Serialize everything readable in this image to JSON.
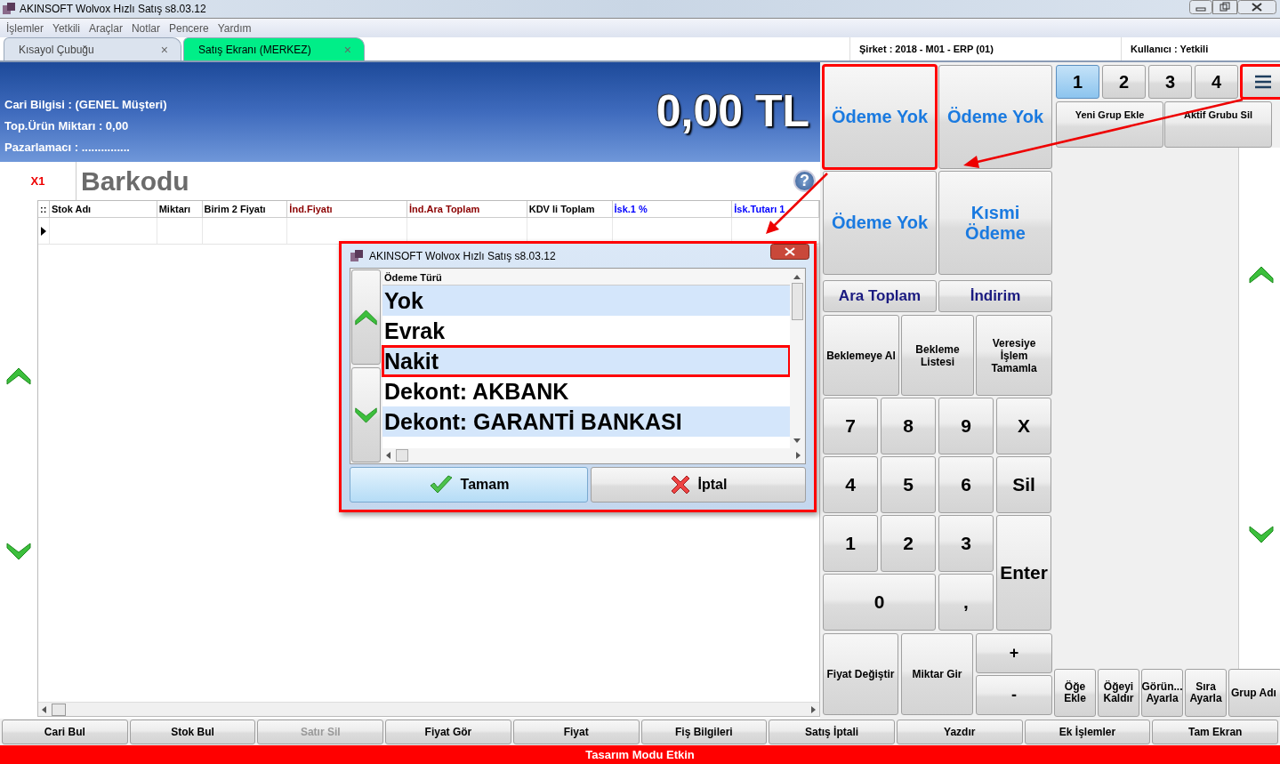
{
  "window": {
    "title": "AKINSOFT Wolvox Hızlı Satış s8.03.12"
  },
  "menu": [
    "İşlemler",
    "Yetkili",
    "Araçlar",
    "Notlar",
    "Pencere",
    "Yardım"
  ],
  "tabs": [
    {
      "label": "Kısayol Çubuğu",
      "close": "×",
      "selected": false
    },
    {
      "label": "Satış Ekranı (MERKEZ)",
      "close": "×",
      "selected": true
    }
  ],
  "session": {
    "company": "Şirket : 2018 - M01 - ERP (01)",
    "user": "Kullanıcı : Yetkili"
  },
  "header": {
    "lines": [
      "Cari Bilgisi : (GENEL Müşteri)",
      "Top.Ürün Miktarı : 0,00",
      "Pazarlamacı : ..............."
    ],
    "total": "0,00 TL"
  },
  "barcode": {
    "multiplier": "X1",
    "placeholder": "Barkodu",
    "help": "?"
  },
  "table": {
    "corner": "::",
    "columns": [
      {
        "label": "Stok Adı",
        "color": "#000000"
      },
      {
        "label": "Miktarı",
        "color": "#000000"
      },
      {
        "label": "Birim 2 Fiyatı",
        "color": "#000000"
      },
      {
        "label": "İnd.Fiyatı",
        "color": "#8b0000"
      },
      {
        "label": "İnd.Ara Toplam",
        "color": "#8b0000"
      },
      {
        "label": "KDV li Toplam",
        "color": "#000000"
      },
      {
        "label": "İsk.1 %",
        "color": "#0000ff"
      },
      {
        "label": "İsk.Tutarı 1",
        "color": "#0000ff"
      }
    ]
  },
  "payment_buttons": [
    {
      "label": "Ödeme Yok",
      "annotated": true
    },
    {
      "label": "Ödeme Yok",
      "annotated": false
    },
    {
      "label": "Ödeme Yok",
      "annotated": false
    },
    {
      "label": "Kısmi Ödeme",
      "annotated": false
    }
  ],
  "total_buttons": [
    "Ara Toplam",
    "İndirim"
  ],
  "hold_buttons": [
    "Beklemeye Al",
    "Bekleme Listesi",
    "Veresiye İşlem Tamamla"
  ],
  "numpad": [
    {
      "label": "7",
      "kind": "key"
    },
    {
      "label": "8",
      "kind": "key"
    },
    {
      "label": "9",
      "kind": "key"
    },
    {
      "label": "X",
      "kind": "key"
    },
    {
      "label": "4",
      "kind": "key"
    },
    {
      "label": "5",
      "kind": "key"
    },
    {
      "label": "6",
      "kind": "key"
    },
    {
      "label": "Sil",
      "kind": "key"
    },
    {
      "label": "1",
      "kind": "key"
    },
    {
      "label": "2",
      "kind": "key"
    },
    {
      "label": "3",
      "kind": "key"
    },
    {
      "label": "Enter",
      "kind": "tall"
    },
    {
      "label": "0",
      "kind": "wide"
    },
    {
      "label": ",",
      "kind": "key"
    }
  ],
  "edit_buttons": [
    "Fiyat Değiştir",
    "Miktar Gir"
  ],
  "sign_buttons": [
    "+",
    "-"
  ],
  "group_tabs": [
    {
      "label": "1",
      "selected": true
    },
    {
      "label": "2",
      "selected": false
    },
    {
      "label": "3",
      "selected": false
    },
    {
      "label": "4",
      "selected": false
    }
  ],
  "group_menu": {
    "annotated": true
  },
  "group_actions": [
    "Yeni Grup Ekle",
    "Aktif Grubu Sil"
  ],
  "item_actions": [
    "Öğe Ekle",
    "Öğeyi Kaldır",
    "Görün... Ayarla",
    "Sıra Ayarla",
    "Grup Adı"
  ],
  "bottom_buttons": [
    {
      "label": "Cari Bul",
      "disabled": false
    },
    {
      "label": "Stok Bul",
      "disabled": false
    },
    {
      "label": "Satır Sil",
      "disabled": true
    },
    {
      "label": "Fiyat Gör",
      "disabled": false
    },
    {
      "label": "Fiyat",
      "disabled": false
    },
    {
      "label": "Fiş Bilgileri",
      "disabled": false
    },
    {
      "label": "Satış İptali",
      "disabled": false
    },
    {
      "label": "Yazdır",
      "disabled": false
    },
    {
      "label": "Ek İşlemler",
      "disabled": false
    },
    {
      "label": "Tam Ekran",
      "disabled": false
    }
  ],
  "status": "Tasarım Modu Etkin",
  "dialog": {
    "title": "AKINSOFT Wolvox Hızlı Satış s8.03.12",
    "annotated": true,
    "column": "Ödeme Türü",
    "options": [
      {
        "label": "Yok",
        "annotated": false
      },
      {
        "label": "Evrak",
        "annotated": false
      },
      {
        "label": "Nakit",
        "annotated": true
      },
      {
        "label": "Dekont: AKBANK",
        "annotated": false
      },
      {
        "label": "Dekont: GARANTİ BANKASI",
        "annotated": false
      }
    ],
    "buttons": [
      {
        "label": "Tamam",
        "kind": "ok"
      },
      {
        "label": "İptal",
        "kind": "cancel"
      }
    ]
  }
}
